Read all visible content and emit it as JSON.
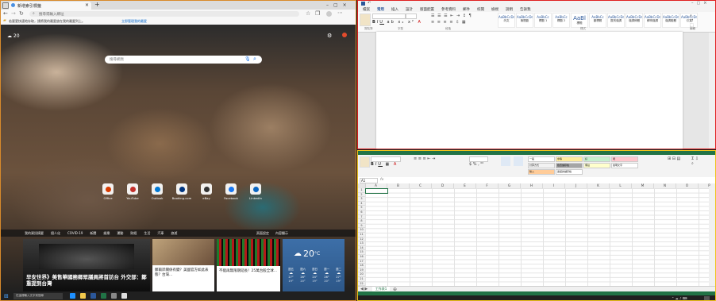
{
  "edge": {
    "tab_title": "新增索引標籤",
    "address": "搜尋或輸入網址",
    "favorites_prompt": "若要更快速地存取，請將我的最愛放在我的最愛列上。",
    "favorites_link": "立即管理我的最愛",
    "weather_short": "20",
    "search_placeholder": "搜尋網頁",
    "quick_links": [
      {
        "label": "Office",
        "color": "#d83b01"
      },
      {
        "label": "YouTube",
        "color": "#c4302b"
      },
      {
        "label": "Outlook",
        "color": "#0078d4"
      },
      {
        "label": "Booking.com",
        "color": "#003580"
      },
      {
        "label": "eBay",
        "color": "#333333"
      },
      {
        "label": "Facebook",
        "color": "#1877f2"
      },
      {
        "label": "LinkedIn",
        "color": "#0a66c2"
      }
    ],
    "news_nav": [
      "我的資訊摘要",
      "個人化",
      "COVID-19",
      "新聞",
      "娛樂",
      "運動",
      "財經",
      "生活",
      "汽車",
      "旅遊"
    ],
    "news_nav_right": [
      "頁面設定",
      "內容顯示"
    ],
    "card_main_title": "早安世界》美售華國務卿眾議員將首訪台 外交部：鄭重提到台灣",
    "card2_title": "鄭兩岸關係有變？美國官方如此表態？台灣...",
    "card3_title": "不能再無限期延長！25萬台股全球...",
    "weather": {
      "temp": "20",
      "unit": "°C",
      "days": [
        {
          "d": "週五",
          "hi": "27°",
          "lo": "19°"
        },
        {
          "d": "週六",
          "hi": "26°",
          "lo": "20°"
        },
        {
          "d": "週日",
          "hi": "24°",
          "lo": "19°"
        },
        {
          "d": "週一",
          "hi": "26°",
          "lo": "20°"
        },
        {
          "d": "週二",
          "hi": "27°",
          "lo": "19°"
        }
      ]
    },
    "taskbar_search": "在這裡輸入文字來搜尋"
  },
  "word": {
    "tabs": [
      "檔案",
      "常用",
      "插入",
      "設計",
      "版面配置",
      "參考資料",
      "郵件",
      "校閱",
      "檢視",
      "說明",
      "告訴我"
    ],
    "styles": [
      {
        "sample": "AaBbCcDd",
        "name": "內文"
      },
      {
        "sample": "AaBbCcDd",
        "name": "無間距"
      },
      {
        "sample": "AaBbCc",
        "name": "標題 1"
      },
      {
        "sample": "AaBbCc",
        "name": "標題 2"
      },
      {
        "sample": "AaBl",
        "name": "標題"
      },
      {
        "sample": "AaBbCc",
        "name": "副標題"
      },
      {
        "sample": "AaBbCcDd",
        "name": "區別強調"
      },
      {
        "sample": "AaBbCcDd",
        "name": "強調斜體"
      },
      {
        "sample": "AaBbCcDd",
        "name": "鮮明強調"
      },
      {
        "sample": "AaBbCcDd",
        "name": "強調粗體"
      },
      {
        "sample": "AaBbCcDd",
        "name": "引文"
      }
    ],
    "group_labels": [
      "剪貼簿",
      "字型",
      "段落",
      "樣式",
      "編輯"
    ]
  },
  "excel": {
    "cell_styles": [
      {
        "t": "一般",
        "c": "#ffffff"
      },
      {
        "t": "中等",
        "c": "#ffeb9c"
      },
      {
        "t": "好",
        "c": "#c6efce"
      },
      {
        "t": "壞",
        "c": "#ffc7ce"
      },
      {
        "t": "計算方式",
        "c": "#f2f2f2"
      },
      {
        "t": "檢查儲存格",
        "c": "#a5a5a5"
      },
      {
        "t": "備註",
        "c": "#ffffcc"
      },
      {
        "t": "說明文字",
        "c": "#ffffff"
      },
      {
        "t": "輸入",
        "c": "#ffcc99"
      },
      {
        "t": "連結的儲存格",
        "c": "#ffffff"
      }
    ],
    "columns": [
      "A",
      "B",
      "C",
      "D",
      "E",
      "F",
      "G",
      "H",
      "I",
      "J",
      "K",
      "L",
      "M",
      "N",
      "O",
      "P"
    ],
    "sheet_tab": "工作表1",
    "name_box": "A1"
  }
}
